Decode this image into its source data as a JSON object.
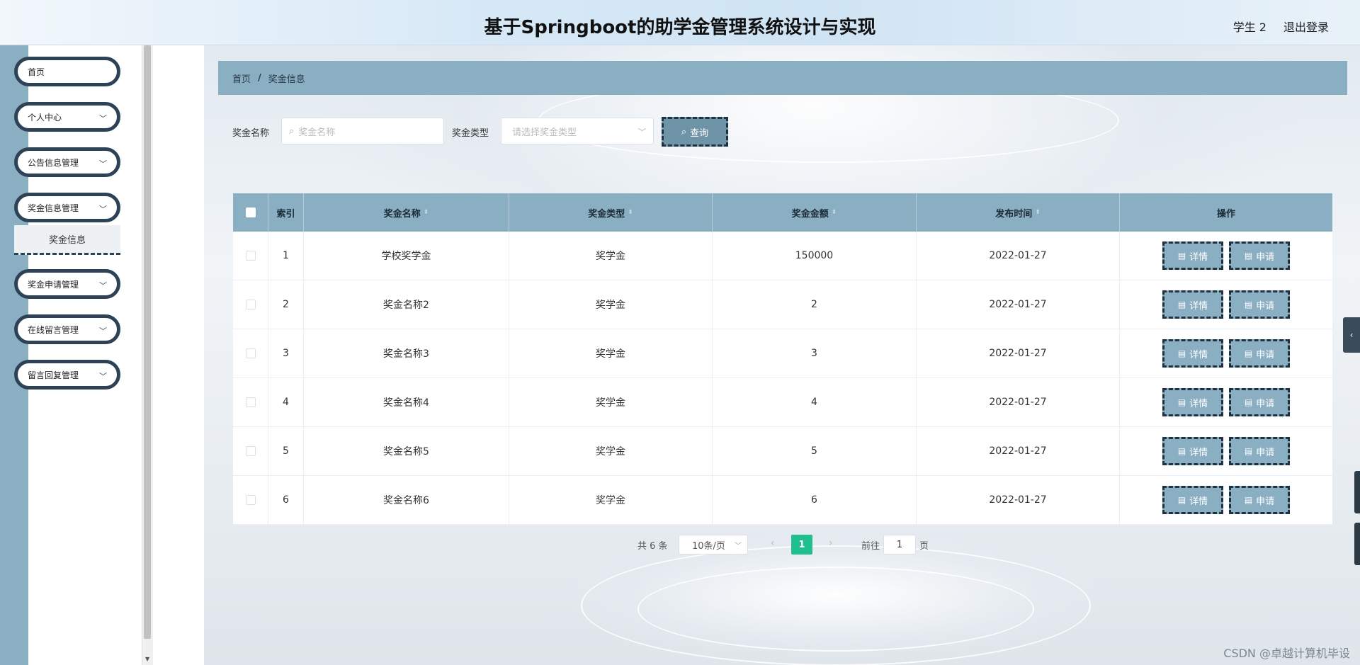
{
  "header": {
    "title": "基于Springboot的助学金管理系统设计与实现",
    "user": "学生 2",
    "logout": "退出登录"
  },
  "sidebar": {
    "items": [
      {
        "label": "首页",
        "has_chevron": false
      },
      {
        "label": "个人中心",
        "has_chevron": true
      },
      {
        "label": "公告信息管理",
        "has_chevron": true
      },
      {
        "label": "奖金信息管理",
        "has_chevron": true
      },
      {
        "label": "奖金申请管理",
        "has_chevron": true
      },
      {
        "label": "在线留言管理",
        "has_chevron": true
      },
      {
        "label": "留言回复管理",
        "has_chevron": true
      }
    ],
    "submenu": {
      "label": "奖金信息"
    }
  },
  "breadcrumb": {
    "home": "首页",
    "separator": "/",
    "current": "奖金信息"
  },
  "search": {
    "name_label": "奖金名称",
    "name_placeholder": "奖金名称",
    "type_label": "奖金类型",
    "type_placeholder": "请选择奖金类型",
    "query_button": "查询"
  },
  "table": {
    "headers": [
      "索引",
      "奖金名称",
      "奖金类型",
      "奖金金额",
      "发布时间",
      "操作"
    ],
    "rows": [
      {
        "index": "1",
        "name": "学校奖学金",
        "type": "奖学金",
        "amount": "150000",
        "date": "2022-01-27"
      },
      {
        "index": "2",
        "name": "奖金名称2",
        "type": "奖学金",
        "amount": "2",
        "date": "2022-01-27"
      },
      {
        "index": "3",
        "name": "奖金名称3",
        "type": "奖学金",
        "amount": "3",
        "date": "2022-01-27"
      },
      {
        "index": "4",
        "name": "奖金名称4",
        "type": "奖学金",
        "amount": "4",
        "date": "2022-01-27"
      },
      {
        "index": "5",
        "name": "奖金名称5",
        "type": "奖学金",
        "amount": "5",
        "date": "2022-01-27"
      },
      {
        "index": "6",
        "name": "奖金名称6",
        "type": "奖学金",
        "amount": "6",
        "date": "2022-01-27"
      }
    ],
    "detail_label": "详情",
    "apply_label": "申请"
  },
  "pagination": {
    "total": "共 6 条",
    "page_size": "10条/页",
    "current_page": "1",
    "goto_prefix": "前往",
    "goto_value": "1",
    "goto_suffix": "页"
  },
  "watermark": "CSDN @卓越计算机毕设",
  "colors": {
    "accent": "#8aaec2",
    "dark_border": "#2d4256",
    "active_page": "#1fbf8f"
  },
  "icons": {
    "search": "search-icon",
    "document": "document-icon",
    "chevron": "chevron-down-icon",
    "sort": "sort-icon"
  }
}
